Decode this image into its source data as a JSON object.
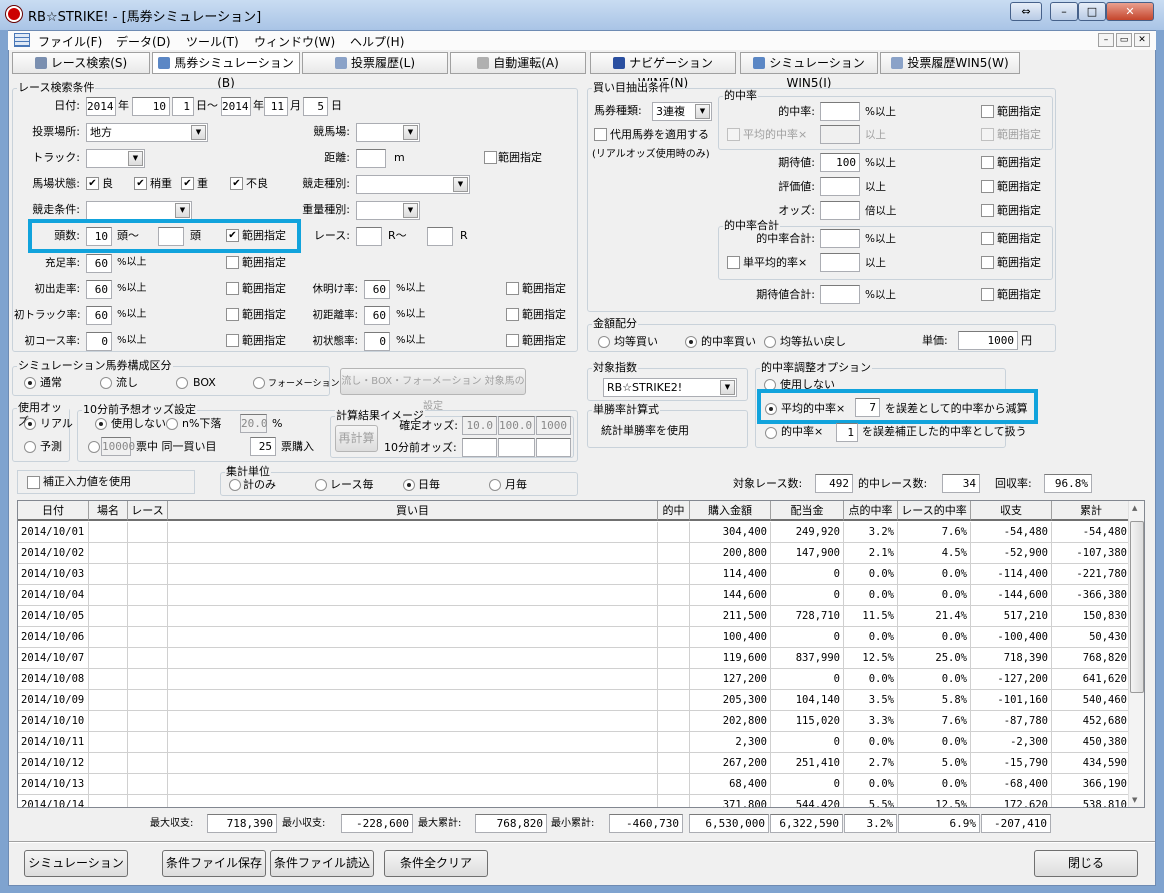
{
  "window": {
    "title": "RB☆STRIKE! - [馬券シミュレーション]",
    "controls": [
      "⇔",
      "–",
      "□",
      "✕"
    ],
    "mdi_controls": [
      "–",
      "▭",
      "✕"
    ]
  },
  "menu": [
    "ファイル(F)",
    "データ(D)",
    "ツール(T)",
    "ウィンドウ(W)",
    "ヘルプ(H)"
  ],
  "tabs": [
    {
      "label": "レース検索(S)",
      "icon": "magnifier-icon",
      "color": "#7a8fb0"
    },
    {
      "label": "馬券シミュレーション(B)",
      "icon": "grid-icon",
      "color": "#5b87c5"
    },
    {
      "label": "投票履歴(L)",
      "icon": "calculator-icon",
      "color": "#8aa2c8"
    },
    {
      "label": "自動運転(A)",
      "icon": "clock-icon",
      "color": "#b0b0b0"
    },
    {
      "label": "ナビゲーションWIN5(N)",
      "icon": "arrow-icon",
      "color": "#2a4fa0"
    },
    {
      "label": "シミュレーションWIN5(I)",
      "icon": "grid-icon",
      "color": "#5b87c5"
    },
    {
      "label": "投票履歴WIN5(W)",
      "icon": "calculator-icon",
      "color": "#8aa2c8"
    }
  ],
  "common": {
    "range": "範囲指定",
    "pct_over": "%以上",
    "over": "以上"
  },
  "race_search": {
    "title": "レース検索条件",
    "date": {
      "label": "日付:",
      "from_year": "2014",
      "year": "年",
      "from_month": "10",
      "month": "月",
      "from_day": "1",
      "day_sep": "日～",
      "to_year": "2014",
      "to_month": "11",
      "to_day": "5",
      "day": "日"
    },
    "venue_type": {
      "label": "投票場所:",
      "value": "地方"
    },
    "course": {
      "label": "競馬場:",
      "value": ""
    },
    "track": {
      "label": "トラック:",
      "value": ""
    },
    "distance": {
      "label": "距離:",
      "value": "",
      "unit": "m",
      "range_checked": false
    },
    "ground": {
      "label": "馬場状態:",
      "options": [
        {
          "label": "良",
          "checked": true
        },
        {
          "label": "稍重",
          "checked": true
        },
        {
          "label": "重",
          "checked": true
        },
        {
          "label": "不良",
          "checked": true
        }
      ]
    },
    "race_type": {
      "label": "競走種別:",
      "value": ""
    },
    "race_cond": {
      "label": "競走条件:",
      "value": ""
    },
    "weight_type": {
      "label": "重量種別:",
      "value": ""
    },
    "heads": {
      "label": "頭数:",
      "from": "10",
      "unit_from": "頭～",
      "to": "",
      "unit_to": "頭",
      "range_checked": true
    },
    "race_no": {
      "label": "レース:",
      "from": "",
      "unit_from": "R～",
      "to": "",
      "unit_to": "R"
    },
    "fill_rate": {
      "label": "充足率:",
      "value": "60"
    },
    "first_run": {
      "label": "初出走率:",
      "value": "60"
    },
    "rest": {
      "label": "休明け率:",
      "value": "60"
    },
    "first_track": {
      "label": "初トラック率:",
      "value": "60"
    },
    "first_dist": {
      "label": "初距離率:",
      "value": "60"
    },
    "first_course": {
      "label": "初コース率:",
      "value": "0"
    },
    "first_state": {
      "label": "初状態率:",
      "value": "0"
    }
  },
  "bet_extract": {
    "title": "買い目抽出条件",
    "bet_type": {
      "label": "馬券種類:",
      "value": "3連複"
    },
    "substitute": {
      "label": "代用馬券を適用する",
      "checked": false,
      "note": "(リアルオッズ使用時のみ)"
    },
    "hit_group": {
      "title": "的中率",
      "hit": {
        "label": "的中率:",
        "value": ""
      },
      "avg": {
        "label": "平均的中率×",
        "value": ""
      }
    },
    "expect": {
      "label": "期待値:",
      "value": "100"
    },
    "rating": {
      "label": "評価値:",
      "value": ""
    },
    "odds": {
      "label": "オッズ:",
      "value": "",
      "unit": "倍以上"
    },
    "hit_sum_group": {
      "title": "的中率合計",
      "sum": {
        "label": "的中率合計:",
        "value": ""
      },
      "single_avg": {
        "label": "単平均的率×",
        "value": ""
      }
    },
    "expect_sum": {
      "label": "期待値合計:",
      "value": ""
    }
  },
  "allocation": {
    "title": "金額配分",
    "options": [
      "均等買い",
      "的中率買い",
      "均等払い戻し"
    ],
    "selected": 1,
    "unit_price_label": "単価:",
    "unit_price": "1000",
    "yen": "円"
  },
  "index": {
    "title": "対象指数",
    "value": "RB☆STRIKE2!"
  },
  "win_formula": {
    "title": "単勝率計算式",
    "value": "統計単勝率を使用"
  },
  "hit_adjust": {
    "title": "的中率調整オプション",
    "none": "使用しない",
    "opt1_label": "平均的中率×",
    "opt1_value": "7",
    "opt1_suffix": "を誤差として的中率から減算",
    "opt2_label": "的中率×",
    "opt2_value": "1",
    "opt2_suffix": "を誤差補正した的中率として扱う",
    "selected": 1
  },
  "composition": {
    "title": "シミュレーション馬券構成区分",
    "options": [
      "通常",
      "流し",
      "BOX",
      "フォーメーション"
    ],
    "selected": 0,
    "setup_button": "流し・BOX・フォーメーション 対象馬の設定"
  },
  "odds_used": {
    "title": "使用オッズ",
    "options": [
      "リアル",
      "予測"
    ],
    "selected": 0
  },
  "pre_odds": {
    "title": "10分前予想オッズ設定",
    "unused": "使用しない",
    "drop_label": "n%下落",
    "drop_value": "20.0",
    "pct": "%",
    "votes": "10000",
    "votes_mid": "票中 同一買い目",
    "buy": "25",
    "buy_suffix": "票購入"
  },
  "calc_image": {
    "title": "計算結果イメージ",
    "recalc": "再計算",
    "final_label": "確定オッズ:",
    "final": [
      "10.0",
      "100.0",
      "1000"
    ],
    "pre_label": "10分前オッズ:",
    "pre": [
      "",
      "",
      ""
    ]
  },
  "correction": {
    "label": "補正入力値を使用",
    "checked": false
  },
  "aggregate": {
    "title": "集計単位",
    "options": [
      "計のみ",
      "レース毎",
      "日毎",
      "月毎"
    ],
    "selected": 2
  },
  "stats": {
    "races_label": "対象レース数:",
    "races": "492",
    "hit_races_label": "的中レース数:",
    "hit_races": "34",
    "return_label": "回収率:",
    "return": "96.8%"
  },
  "table": {
    "columns": [
      "日付",
      "場名",
      "レース",
      "買い目",
      "的中",
      "購入金額",
      "配当金",
      "点的中率",
      "レース的中率",
      "収支",
      "累計"
    ],
    "rows": [
      [
        "2014/10/01",
        "",
        "",
        "",
        "",
        "304,400",
        "249,920",
        "3.2%",
        "7.6%",
        "-54,480",
        "-54,480"
      ],
      [
        "2014/10/02",
        "",
        "",
        "",
        "",
        "200,800",
        "147,900",
        "2.1%",
        "4.5%",
        "-52,900",
        "-107,380"
      ],
      [
        "2014/10/03",
        "",
        "",
        "",
        "",
        "114,400",
        "0",
        "0.0%",
        "0.0%",
        "-114,400",
        "-221,780"
      ],
      [
        "2014/10/04",
        "",
        "",
        "",
        "",
        "144,600",
        "0",
        "0.0%",
        "0.0%",
        "-144,600",
        "-366,380"
      ],
      [
        "2014/10/05",
        "",
        "",
        "",
        "",
        "211,500",
        "728,710",
        "11.5%",
        "21.4%",
        "517,210",
        "150,830"
      ],
      [
        "2014/10/06",
        "",
        "",
        "",
        "",
        "100,400",
        "0",
        "0.0%",
        "0.0%",
        "-100,400",
        "50,430"
      ],
      [
        "2014/10/07",
        "",
        "",
        "",
        "",
        "119,600",
        "837,990",
        "12.5%",
        "25.0%",
        "718,390",
        "768,820"
      ],
      [
        "2014/10/08",
        "",
        "",
        "",
        "",
        "127,200",
        "0",
        "0.0%",
        "0.0%",
        "-127,200",
        "641,620"
      ],
      [
        "2014/10/09",
        "",
        "",
        "",
        "",
        "205,300",
        "104,140",
        "3.5%",
        "5.8%",
        "-101,160",
        "540,460"
      ],
      [
        "2014/10/10",
        "",
        "",
        "",
        "",
        "202,800",
        "115,020",
        "3.3%",
        "7.6%",
        "-87,780",
        "452,680"
      ],
      [
        "2014/10/11",
        "",
        "",
        "",
        "",
        "2,300",
        "0",
        "0.0%",
        "0.0%",
        "-2,300",
        "450,380"
      ],
      [
        "2014/10/12",
        "",
        "",
        "",
        "",
        "267,200",
        "251,410",
        "2.7%",
        "5.0%",
        "-15,790",
        "434,590"
      ],
      [
        "2014/10/13",
        "",
        "",
        "",
        "",
        "68,400",
        "0",
        "0.0%",
        "0.0%",
        "-68,400",
        "366,190"
      ],
      [
        "2014/10/14",
        "",
        "",
        "",
        "",
        "371,800",
        "544,420",
        "5.5%",
        "12.5%",
        "172,620",
        "538,810"
      ]
    ]
  },
  "summary": {
    "max_balance_label": "最大収支:",
    "max_balance": "718,390",
    "min_balance_label": "最小収支:",
    "min_balance": "-228,600",
    "max_cum_label": "最大累計:",
    "max_cum": "768,820",
    "min_cum_label": "最小累計:",
    "min_cum": "-460,730",
    "totals": [
      "6,530,000",
      "6,322,590",
      "3.2%",
      "6.9%",
      "-207,410"
    ]
  },
  "buttons": {
    "simulate": "シミュレーション",
    "save": "条件ファイル保存",
    "load": "条件ファイル読込",
    "clear": "条件全クリア",
    "close": "閉じる"
  },
  "highlight_color": "#11a3dc"
}
